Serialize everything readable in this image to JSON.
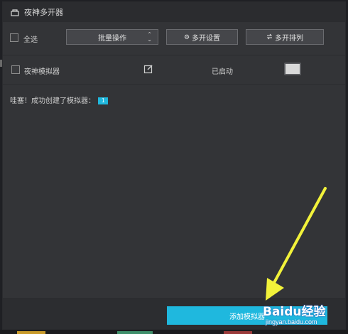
{
  "window": {
    "title": "夜神多开器"
  },
  "toolbar": {
    "select_all_label": "全选",
    "batch_dropdown_label": "批量操作",
    "multi_settings_label": "多开设置",
    "multi_arrange_label": "多开排列"
  },
  "emulators": [
    {
      "name": "夜神模拟器",
      "status": "已启动"
    }
  ],
  "message": {
    "text": "哇塞！成功创建了模拟器：",
    "count": "1"
  },
  "footer": {
    "add_button_label": "添加模拟器"
  },
  "watermark": {
    "logo_text": "Baidu经验",
    "subtitle": "jingyan.baidu.com"
  },
  "colors": {
    "accent": "#1fb8de",
    "background": "#333437",
    "arrow": "#f2f23a"
  },
  "icons": {
    "title": "multi-instance-icon",
    "settings": "gear-icon",
    "arrange": "arrange-icon",
    "edit": "edit-icon",
    "dropdown": "chevron-updown-icon"
  }
}
